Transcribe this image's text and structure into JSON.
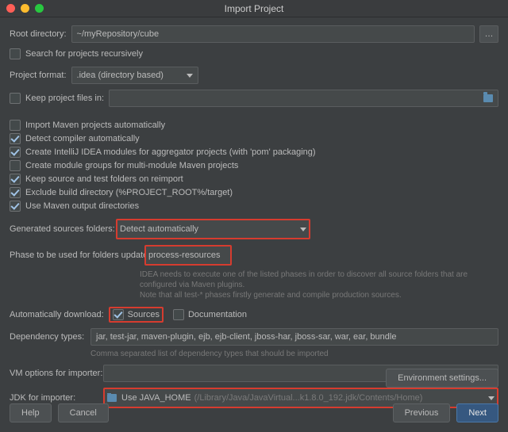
{
  "title": "Import Project",
  "root_dir": {
    "label": "Root directory:",
    "value": "~/myRepository/cube"
  },
  "opts": {
    "search_recursive": "Search for projects recursively",
    "project_format_label": "Project format:",
    "project_format_value": ".idea (directory based)",
    "keep_files_in": "Keep project files in:",
    "import_maven": "Import Maven projects automatically",
    "detect_compiler": "Detect compiler automatically",
    "aggregator": "Create IntelliJ IDEA modules for aggregator projects (with 'pom' packaging)",
    "module_groups": "Create module groups for multi-module Maven projects",
    "keep_source": "Keep source and test folders on reimport",
    "exclude_build": "Exclude build directory (%PROJECT_ROOT%/target)",
    "use_maven_out": "Use Maven output directories"
  },
  "gen_src": {
    "label": "Generated sources folders:",
    "value": "Detect automatically"
  },
  "phase": {
    "label": "Phase to be used for folders update:",
    "value": "process-resources",
    "hint1": "IDEA needs to execute one of the listed phases in order to discover all source folders that are configured via Maven plugins.",
    "hint2": "Note that all test-* phases firstly generate and compile production sources."
  },
  "auto_dl": {
    "label": "Automatically download:",
    "sources": "Sources",
    "docs": "Documentation"
  },
  "dep": {
    "label": "Dependency types:",
    "value": "jar, test-jar, maven-plugin, ejb, ejb-client, jboss-har, jboss-sar, war, ear, bundle",
    "hint": "Comma separated list of dependency types that should be imported"
  },
  "vm": {
    "label": "VM options for importer:",
    "value": ""
  },
  "jdk": {
    "label": "JDK for importer:",
    "value": "Use JAVA_HOME",
    "path": "(/Library/Java/JavaVirtual...k1.8.0_192.jdk/Contents/Home)"
  },
  "buttons": {
    "env": "Environment settings...",
    "help": "Help",
    "cancel": "Cancel",
    "previous": "Previous",
    "next": "Next"
  }
}
